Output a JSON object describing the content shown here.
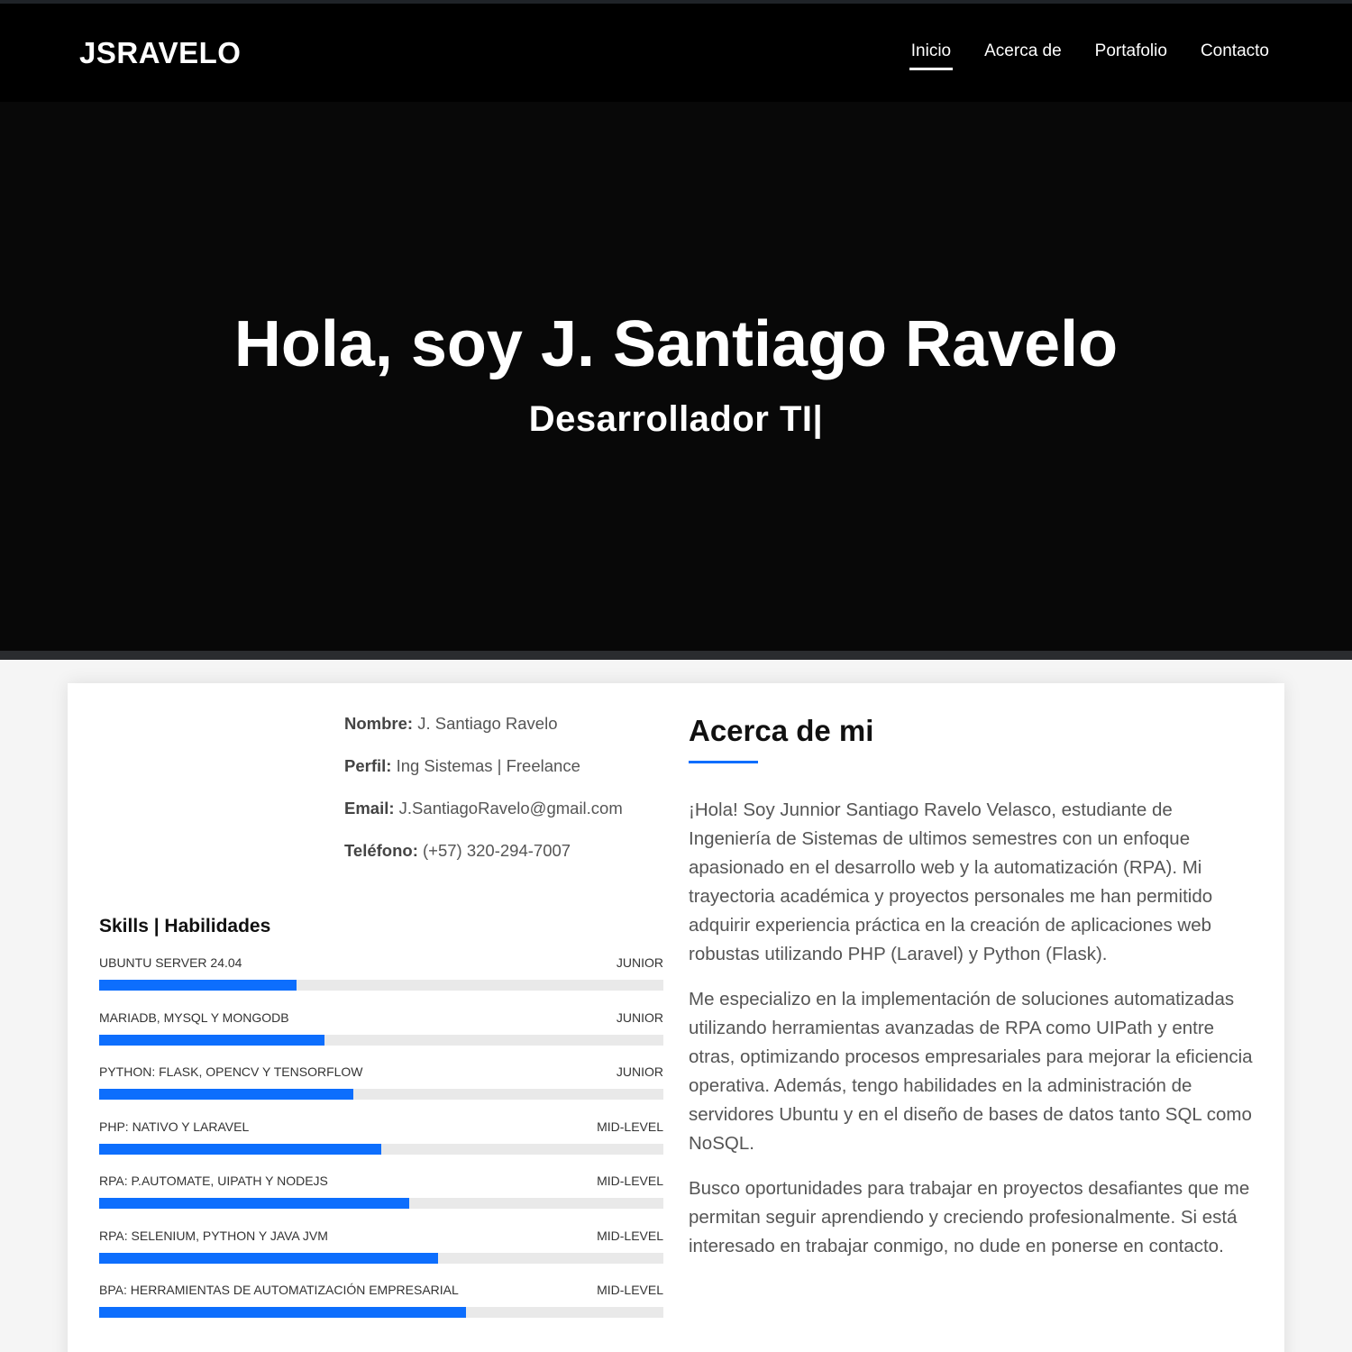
{
  "nav": {
    "brand": "JSRAVELO",
    "links": [
      "Inicio",
      "Acerca de",
      "Portafolio",
      "Contacto"
    ],
    "active": "Inicio"
  },
  "hero": {
    "title": "Hola, soy J. Santiago Ravelo",
    "subtitle": "Desarrollador TI|"
  },
  "info": [
    {
      "label": "Nombre:",
      "value": "J. Santiago Ravelo"
    },
    {
      "label": "Perfil:",
      "value": "Ing Sistemas | Freelance"
    },
    {
      "label": "Email:",
      "value": "J.SantiagoRavelo@gmail.com"
    },
    {
      "label": "Teléfono:",
      "value": "(+57) 320-294-7007"
    }
  ],
  "skills": {
    "title": "Skills | Habilidades",
    "items": [
      {
        "name": "UBUNTU SERVER 24.04",
        "level": "JUNIOR",
        "percent": 35
      },
      {
        "name": "MARIADB, MYSQL Y MONGODB",
        "level": "JUNIOR",
        "percent": 40
      },
      {
        "name": "PYTHON: FLASK, OPENCV Y TENSORFLOW",
        "level": "JUNIOR",
        "percent": 45
      },
      {
        "name": "PHP: NATIVO Y LARAVEL",
        "level": "MID-LEVEL",
        "percent": 50
      },
      {
        "name": "RPA: P.AUTOMATE, UIPATH Y NODEJS",
        "level": "MID-LEVEL",
        "percent": 55
      },
      {
        "name": "RPA: SELENIUM, PYTHON Y JAVA JVM",
        "level": "MID-LEVEL",
        "percent": 60
      },
      {
        "name": "BPA: HERRAMIENTAS DE AUTOMATIZACIÓN EMPRESARIAL",
        "level": "MID-LEVEL",
        "percent": 65
      }
    ]
  },
  "about": {
    "title": "Acerca de mi",
    "paragraphs": [
      "¡Hola! Soy Junnior Santiago Ravelo Velasco, estudiante de Ingeniería de Sistemas de ultimos semestres con un enfoque apasionado en el desarrollo web y la automatización (RPA). Mi trayectoria académica y proyectos personales me han permitido adquirir experiencia práctica en la creación de aplicaciones web robustas utilizando PHP (Laravel) y Python (Flask).",
      "Me especializo en la implementación de soluciones automatizadas utilizando herramientas avanzadas de RPA como UIPath y entre otras, optimizando procesos empresariales para mejorar la eficiencia operativa. Además, tengo habilidades en la administración de servidores Ubuntu y en el diseño de bases de datos tanto SQL como NoSQL.",
      "Busco oportunidades para trabajar en proyectos desafiantes que me permitan seguir aprendiendo y creciendo profesionalmente. Si está interesado en trabajar conmigo, no dude en ponerse en contacto."
    ]
  },
  "colors": {
    "accent": "#0d6efd",
    "navbar": "#000000",
    "hero": "#080808"
  }
}
